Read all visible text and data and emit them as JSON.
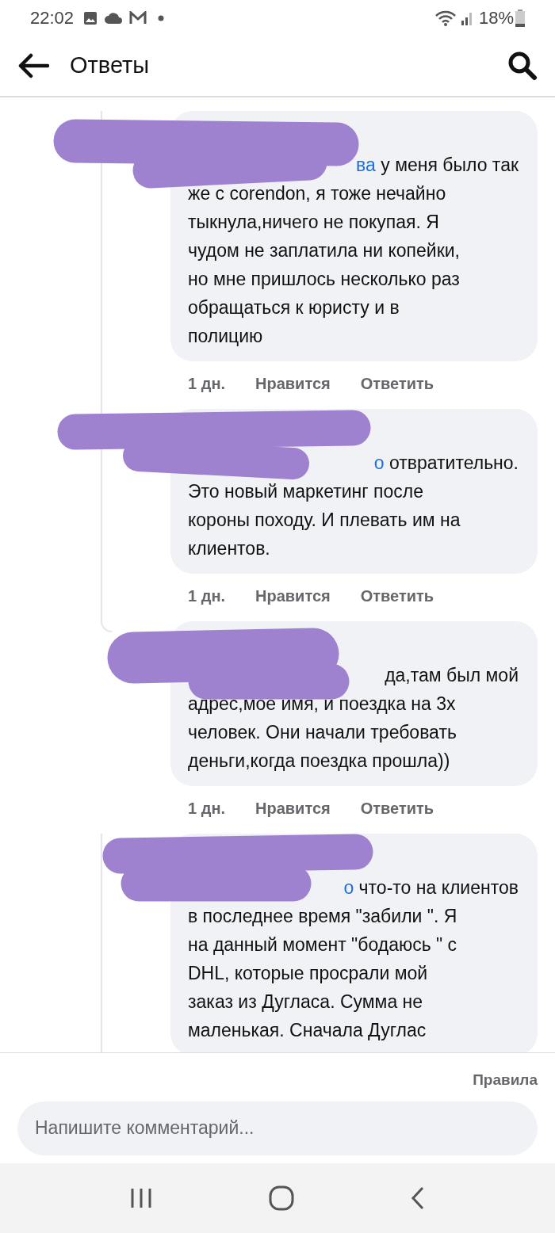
{
  "status_bar": {
    "time": "22:02",
    "battery": "18%"
  },
  "header": {
    "title": "Ответы"
  },
  "threads": [
    {
      "comments": [
        {
          "mention": "ва",
          "lines": [
            "у меня было так",
            "же с corendon, я тоже нечайно",
            "тыкнула,ничего не покупая. Я",
            "чудом не заплатила ни копейки,",
            "но мне пришлось несколько раз",
            "обращаться к юристу и в",
            "полицию"
          ],
          "time": "1 дн.",
          "actions": [
            "Нравится",
            "Ответить"
          ]
        },
        {
          "mention": "о",
          "lines": [
            "отвратительно.",
            "Это новый маркетинг после",
            "короны походу. И плевать им на",
            "клиентов."
          ],
          "time": "1 дн.",
          "actions": [
            "Нравится",
            "Ответить"
          ]
        },
        {
          "lines": [
            "да,там был мой",
            "адрес,мое имя, и поездка на 3х",
            "человек. Они начали требовать",
            "деньги,когда поездка прошла))"
          ],
          "time": "1 дн.",
          "actions": [
            "Нравится",
            "Ответить"
          ]
        }
      ]
    },
    {
      "comments": [
        {
          "mention": "о",
          "lines": [
            "что-то на клиентов",
            "в последнее время \"забили \". Я",
            "на данный момент \"бодаюсь \" с",
            "DHL, которые просрали мой",
            "заказ из Дугласа. Сумма не",
            "маленькая. Сначала Дуглас"
          ]
        }
      ]
    }
  ],
  "footer": {
    "rules": "Правила",
    "comment_field": {
      "placeholder": "Напишите комментарий..."
    }
  }
}
